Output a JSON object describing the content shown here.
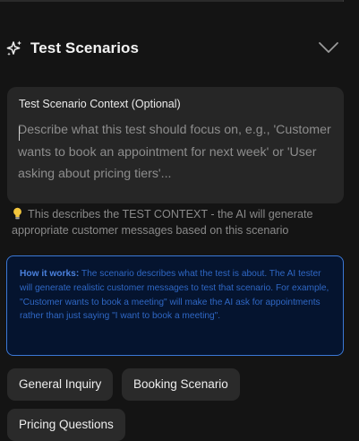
{
  "section": {
    "title": "Test Scenarios"
  },
  "context": {
    "label": "Test Scenario Context (Optional)",
    "placeholder": "Describe what this test should focus on, e.g., 'Customer wants to book an appointment for next week' or 'User asking about pricing tiers'...",
    "value": ""
  },
  "hint": {
    "text": "This describes the TEST CONTEXT - the AI will generate appropriate customer messages based on this scenario"
  },
  "info": {
    "heading": "How it works:",
    "body": "The scenario describes what the test is about. The AI tester will generate realistic customer messages to test that scenario. For example, \"Customer wants to book a meeting\" will make the AI ask for appointments rather than just saying \"I want to book a meeting\"."
  },
  "chips": [
    {
      "label": "General Inquiry"
    },
    {
      "label": "Booking Scenario"
    },
    {
      "label": "Pricing Questions"
    }
  ],
  "colors": {
    "background": "#141414",
    "surface": "#262626",
    "info_border": "#3b78d6",
    "info_text": "#2f67c4"
  },
  "icons": {
    "section": "sparkle-icon",
    "toggle": "chevron-down-icon",
    "hint": "lightbulb-icon"
  }
}
